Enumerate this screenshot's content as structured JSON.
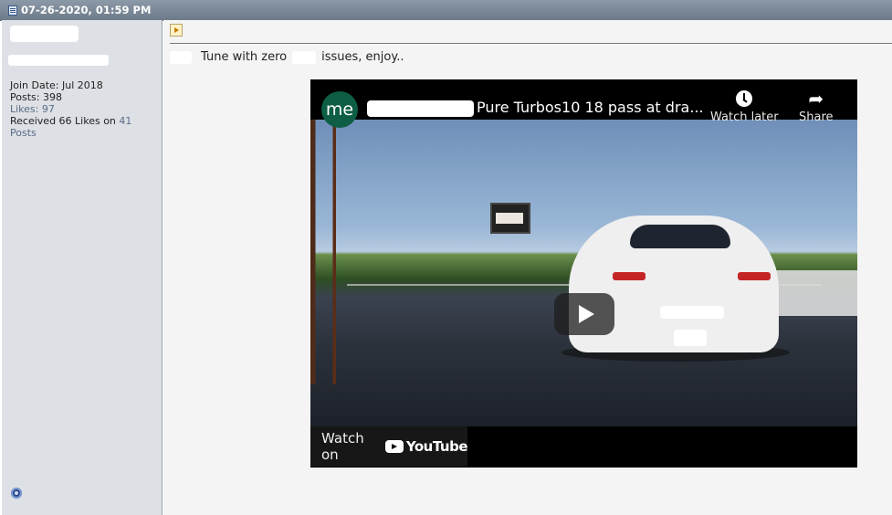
{
  "post": {
    "date": "07-26-2020, 01:59 PM"
  },
  "user": {
    "join_date": "Join Date: Jul 2018",
    "posts": "Posts: 398",
    "likes": "Likes: 97",
    "received_prefix": "Received 66 Likes on",
    "received_count": "41",
    "received_suffix": "Posts"
  },
  "message": {
    "text_a": "Tune with zero",
    "text_b": "issues, enjoy.."
  },
  "video": {
    "channel_initials": "me",
    "title": "Pure Turbos10 18 pass at dra...",
    "watch_later": "Watch later",
    "share": "Share",
    "watch_on": "Watch on",
    "brand": "YouTube"
  },
  "icons": {
    "doc": "document-icon",
    "expand": "expand-arrow-icon",
    "status": "online-status-icon",
    "clock": "clock-icon",
    "share": "share-arrow-icon",
    "play": "play-icon",
    "youtube": "youtube-logo-icon"
  },
  "colors": {
    "header": "#7b8896",
    "sidebar": "#dde0e4",
    "link": "#5a6c88",
    "avatar": "#0d5e45"
  }
}
